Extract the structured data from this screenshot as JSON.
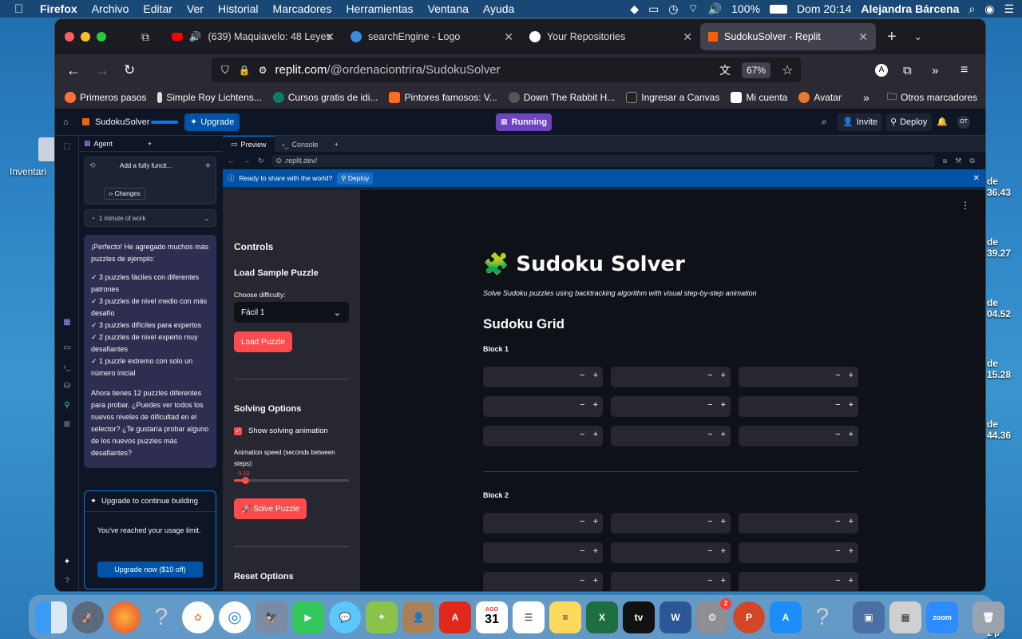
{
  "menubar": {
    "app": "Firefox",
    "items": [
      "Archivo",
      "Editar",
      "Ver",
      "Historial",
      "Marcadores",
      "Herramientas",
      "Ventana",
      "Ayuda"
    ],
    "battery": "100%",
    "clock": "Dom 20:14",
    "user": "Alejandra Bárcena"
  },
  "desktop": {
    "label": "Inventari",
    "right_items": [
      {
        "l": "de",
        "v": "36.43"
      },
      {
        "l": "de",
        "v": "39.27"
      },
      {
        "l": "de",
        "v": "04.52"
      },
      {
        "l": "de",
        "v": "15.28"
      },
      {
        "l": "de",
        "v": "44.36"
      }
    ],
    "right_bottom": "2 p"
  },
  "tabs": [
    {
      "label": "(639) Maquiavelo: 48 Leyes",
      "icon": "youtube-icon"
    },
    {
      "label": "searchEngine - Logo",
      "icon": "canva-icon"
    },
    {
      "label": "Your Repositories",
      "icon": "github-icon"
    },
    {
      "label": "SudokuSolver - Replit",
      "icon": "replit-icon"
    }
  ],
  "url": {
    "host": "replit.com",
    "path": "/@ordenaciontrira/SudokuSolver",
    "zoom": "67%"
  },
  "bookmarks": [
    "Primeros pasos",
    "Simple Roy Lichtens...",
    "Cursos gratis de idi...",
    "Pintores famosos: V...",
    "Down The Rabbit H...",
    "Ingresar a Canvas",
    "Mi cuenta",
    "Avatar"
  ],
  "bookmarks_other": "Otros marcadores",
  "replit": {
    "repl_name": "SudokuSolver",
    "upgrade": "Upgrade",
    "status": "Running",
    "invite": "Invite",
    "deploy": "Deploy",
    "avatar": "OT"
  },
  "agent": {
    "tab": "Agent",
    "history_item": "Add a fully functi...",
    "changes": "Changes",
    "work_time": "1 minute of work",
    "message_intro": "¡Perfecto! He agregado muchos más puzzles de ejemplo:",
    "bullets": [
      "✓ 3 puzzles fáciles con diferentes patrones",
      "✓ 3 puzzles de nivel medio con más desafío",
      "✓ 3 puzzles difíciles para expertos",
      "✓ 2 puzzles de nivel experto muy desafiantes",
      "✓ 1 puzzle extremo con solo un número inicial"
    ],
    "message_outro": "Ahora tienes 12 puzzles diferentes para probar. ¿Puedes ver todos los nuevos niveles de dificultad en el selector? ¿Te gustaría probar alguno de los nuevos puzzles más desafiantes?",
    "upgrade_title": "Upgrade to continue building",
    "upgrade_text": "You've reached your usage limit.",
    "upgrade_btn": "Upgrade now ($10 off)"
  },
  "preview": {
    "tab_preview": "Preview",
    "tab_console": "Console",
    "url": ".replit.dev/",
    "banner_text": "Ready to share with the world?",
    "banner_btn": "Deploy"
  },
  "app": {
    "sidebar": {
      "controls": "Controls",
      "load_heading": "Load Sample Puzzle",
      "difficulty_label": "Choose difficulty:",
      "difficulty_value": "Fácil 1",
      "load_btn": "Load Puzzle",
      "solving_heading": "Solving Options",
      "show_anim": "Show solving animation",
      "speed_label": "Animation speed (seconds between steps):",
      "speed_value": "0.10",
      "speed_fraction": 0.1,
      "solve_btn": "🚀 Solve Puzzle",
      "reset_heading": "Reset Options"
    },
    "title": "🧩 Sudoku Solver",
    "subtitle": "Solve Sudoku puzzles using backtracking algorithm with visual step-by-step animation",
    "grid_heading": "Sudoku Grid",
    "block1": "Block 1",
    "block2": "Block 2"
  },
  "dock": [
    "Finder",
    "Launchpad",
    "Firefox",
    "?",
    "Photos",
    "Safari",
    "Preview",
    "FaceTime",
    "Messages",
    "Maps",
    "Contacts",
    "Acrobat",
    "31",
    "Reminders",
    "Notes",
    "Excel",
    "TV",
    "Word",
    "Settings",
    "PowerPoint",
    "App Store",
    "?",
    "Preview",
    "Calculator",
    "zoom",
    "Trash"
  ],
  "dock_calendar_month": "AGO",
  "dock_badge": "2"
}
